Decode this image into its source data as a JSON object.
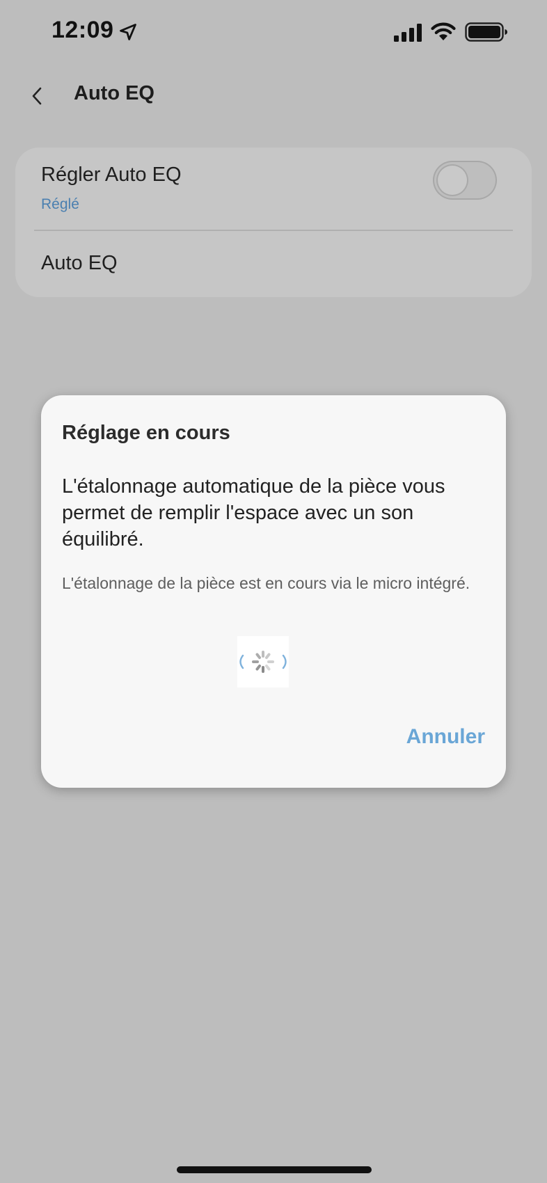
{
  "status_bar": {
    "time": "12:09",
    "icons": [
      "location-arrow-icon",
      "cellular-signal-icon",
      "wifi-icon",
      "battery-icon"
    ]
  },
  "nav": {
    "back_icon": "chevron-left-icon",
    "title": "Auto EQ"
  },
  "settings": {
    "calibrate_title": "Régler Auto EQ",
    "calibrate_status": "Réglé",
    "auto_eq_label": "Auto EQ",
    "auto_eq_enabled": false
  },
  "dialog": {
    "title": "Réglage en cours",
    "body": "L'étalonnage automatique de la pièce vous permet de remplir l'espace avec un son équilibré.",
    "note": "L'étalonnage de la pièce est en cours via le micro intégré.",
    "spinner_icon": "loading-spinner-icon",
    "cancel_label": "Annuler"
  },
  "colors": {
    "background": "#bdbdbd",
    "card": "#c6c6c6",
    "dialog": "#f7f7f7",
    "accent": "#6aa6d6",
    "status_link": "#4a7fb0"
  }
}
